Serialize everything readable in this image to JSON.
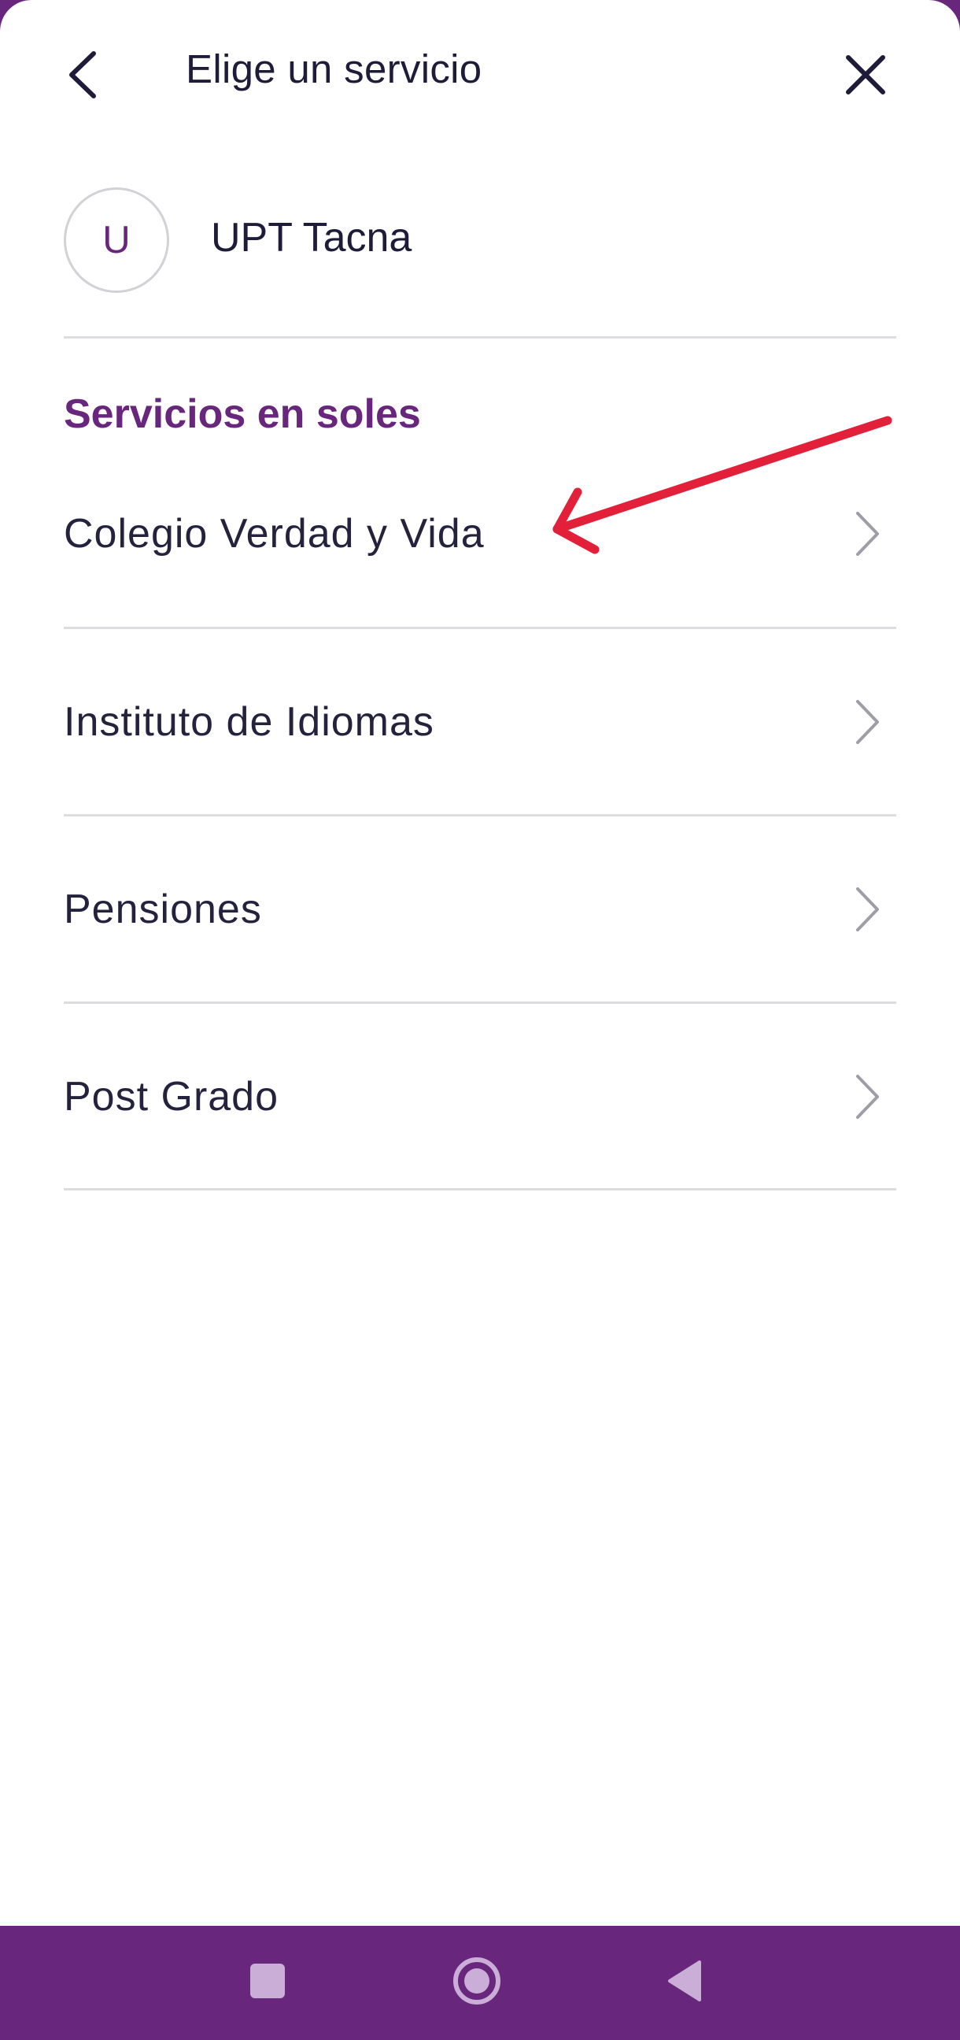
{
  "header": {
    "title": "Elige un servicio",
    "back_icon": "chevron-left-icon",
    "close_icon": "close-icon"
  },
  "merchant": {
    "initial": "U",
    "name": "UPT Tacna"
  },
  "services": {
    "section_title": "Servicios en soles",
    "items": [
      {
        "label": "Colegio Verdad y Vida"
      },
      {
        "label": "Instituto de Idiomas"
      },
      {
        "label": "Pensiones"
      },
      {
        "label": "Post Grado"
      }
    ]
  },
  "annotation": {
    "type": "arrow",
    "color": "#e3203a"
  },
  "navigation_bar": {
    "buttons": [
      "recents-icon",
      "home-icon",
      "back-triangle-icon"
    ]
  },
  "colors": {
    "brand": "#68267d",
    "text": "#1f1c3a",
    "divider": "#dddde0",
    "chevron": "#9e9ea6"
  }
}
